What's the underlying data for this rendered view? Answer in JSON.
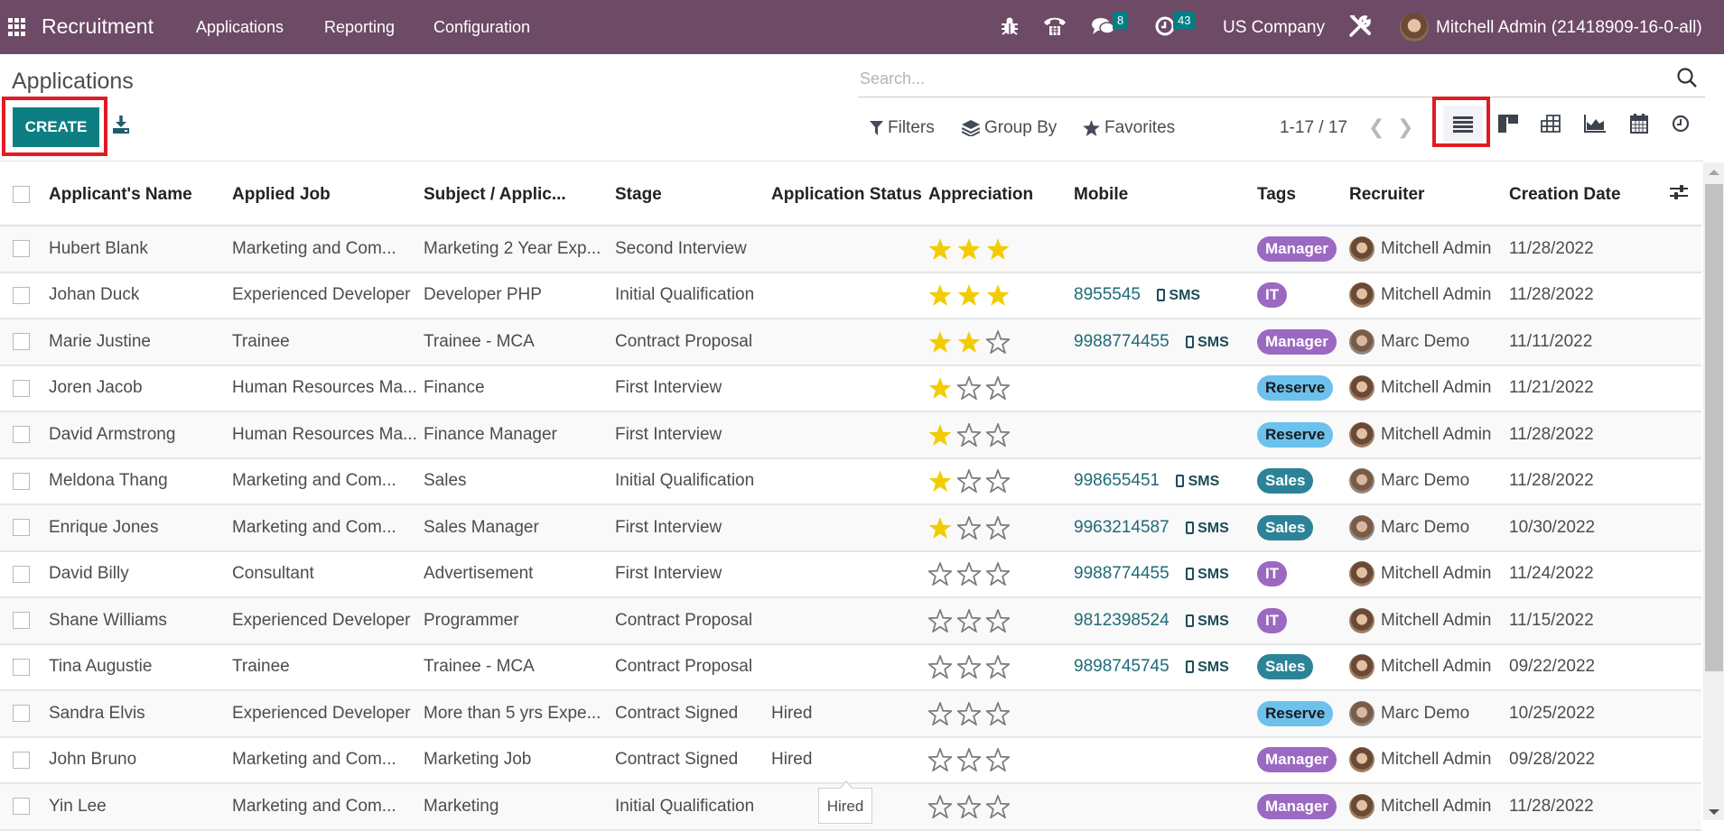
{
  "navbar": {
    "app_name": "Recruitment",
    "menu": [
      "Applications",
      "Reporting",
      "Configuration"
    ],
    "chat_badge": "8",
    "activity_badge": "43",
    "company": "US Company",
    "user": "Mitchell Admin (21418909-16-0-all)"
  },
  "page": {
    "title": "Applications",
    "create_label": "CREATE"
  },
  "search": {
    "placeholder": "Search...",
    "value": "",
    "filters_label": "Filters",
    "groupby_label": "Group By",
    "favorites_label": "Favorites"
  },
  "pager": {
    "range": "1-17 / 17"
  },
  "views": [
    "list",
    "kanban",
    "pivot",
    "graph",
    "calendar",
    "activity"
  ],
  "active_view": "list",
  "table": {
    "columns": [
      "Applicant's Name",
      "Applied Job",
      "Subject / Applic...",
      "Stage",
      "Application Status",
      "Appreciation",
      "Mobile",
      "Tags",
      "Recruiter",
      "Creation Date"
    ],
    "sms_label": "SMS",
    "rows": [
      {
        "name": "Hubert Blank",
        "job": "Marketing and Com...",
        "subject": "Marketing 2 Year Exp...",
        "stage": "Second Interview",
        "status": "",
        "stars": 3,
        "mobile": "",
        "tag": "Manager",
        "recruiter": "Mitchell Admin",
        "date": "11/28/2022"
      },
      {
        "name": "Johan Duck",
        "job": "Experienced Developer",
        "subject": "Developer PHP",
        "stage": "Initial Qualification",
        "status": "",
        "stars": 3,
        "mobile": "8955545",
        "tag": "IT",
        "recruiter": "Mitchell Admin",
        "date": "11/28/2022"
      },
      {
        "name": "Marie Justine",
        "job": "Trainee",
        "subject": "Trainee - MCA",
        "stage": "Contract Proposal",
        "status": "",
        "stars": 2,
        "mobile": "9988774455",
        "tag": "Manager",
        "recruiter": "Marc Demo",
        "date": "11/11/2022"
      },
      {
        "name": "Joren Jacob",
        "job": "Human Resources Ma...",
        "subject": "Finance",
        "stage": "First Interview",
        "status": "",
        "stars": 1,
        "mobile": "",
        "tag": "Reserve",
        "recruiter": "Mitchell Admin",
        "date": "11/21/2022"
      },
      {
        "name": "David Armstrong",
        "job": "Human Resources Ma...",
        "subject": "Finance Manager",
        "stage": "First Interview",
        "status": "",
        "stars": 1,
        "mobile": "",
        "tag": "Reserve",
        "recruiter": "Mitchell Admin",
        "date": "11/28/2022"
      },
      {
        "name": "Meldona Thang",
        "job": "Marketing and Com...",
        "subject": "Sales",
        "stage": "Initial Qualification",
        "status": "",
        "stars": 1,
        "mobile": "998655451",
        "tag": "Sales",
        "recruiter": "Marc Demo",
        "date": "11/28/2022"
      },
      {
        "name": "Enrique Jones",
        "job": "Marketing and Com...",
        "subject": "Sales Manager",
        "stage": "First Interview",
        "status": "",
        "stars": 1,
        "mobile": "9963214587",
        "tag": "Sales",
        "recruiter": "Marc Demo",
        "date": "10/30/2022"
      },
      {
        "name": "David Billy",
        "job": "Consultant",
        "subject": "Advertisement",
        "stage": "First Interview",
        "status": "",
        "stars": 0,
        "mobile": "9988774455",
        "tag": "IT",
        "recruiter": "Mitchell Admin",
        "date": "11/24/2022"
      },
      {
        "name": "Shane Williams",
        "job": "Experienced Developer",
        "subject": "Programmer",
        "stage": "Contract Proposal",
        "status": "",
        "stars": 0,
        "mobile": "9812398524",
        "tag": "IT",
        "recruiter": "Mitchell Admin",
        "date": "11/15/2022"
      },
      {
        "name": "Tina Augustie",
        "job": "Trainee",
        "subject": "Trainee - MCA",
        "stage": "Contract Proposal",
        "status": "",
        "stars": 0,
        "mobile": "9898745745",
        "tag": "Sales",
        "recruiter": "Mitchell Admin",
        "date": "09/22/2022"
      },
      {
        "name": "Sandra Elvis",
        "job": "Experienced Developer",
        "subject": "More than 5 yrs Expe...",
        "stage": "Contract Signed",
        "status": "Hired",
        "stars": 0,
        "mobile": "",
        "tag": "Reserve",
        "recruiter": "Marc Demo",
        "date": "10/25/2022"
      },
      {
        "name": "John Bruno",
        "job": "Marketing and Com...",
        "subject": "Marketing Job",
        "stage": "Contract Signed",
        "status": "Hired",
        "stars": 0,
        "mobile": "",
        "tag": "Manager",
        "recruiter": "Mitchell Admin",
        "date": "09/28/2022"
      },
      {
        "name": "Yin Lee",
        "job": "Marketing and Com...",
        "subject": "Marketing",
        "stage": "Initial Qualification",
        "status": "",
        "stars": 0,
        "mobile": "",
        "tag": "Manager",
        "recruiter": "Mitchell Admin",
        "date": "11/28/2022"
      }
    ]
  },
  "tag_colors": {
    "Manager": "#9b68c2",
    "IT": "#9b68c2",
    "Reserve": "#6cc1ed",
    "Sales": "#2c8397"
  },
  "colors": {
    "navbar": "#6d4a66",
    "primary": "#0d7f83",
    "star_on": "#f3cc00",
    "highlight": "#e01b24"
  },
  "tooltip": {
    "text": "Hired"
  }
}
